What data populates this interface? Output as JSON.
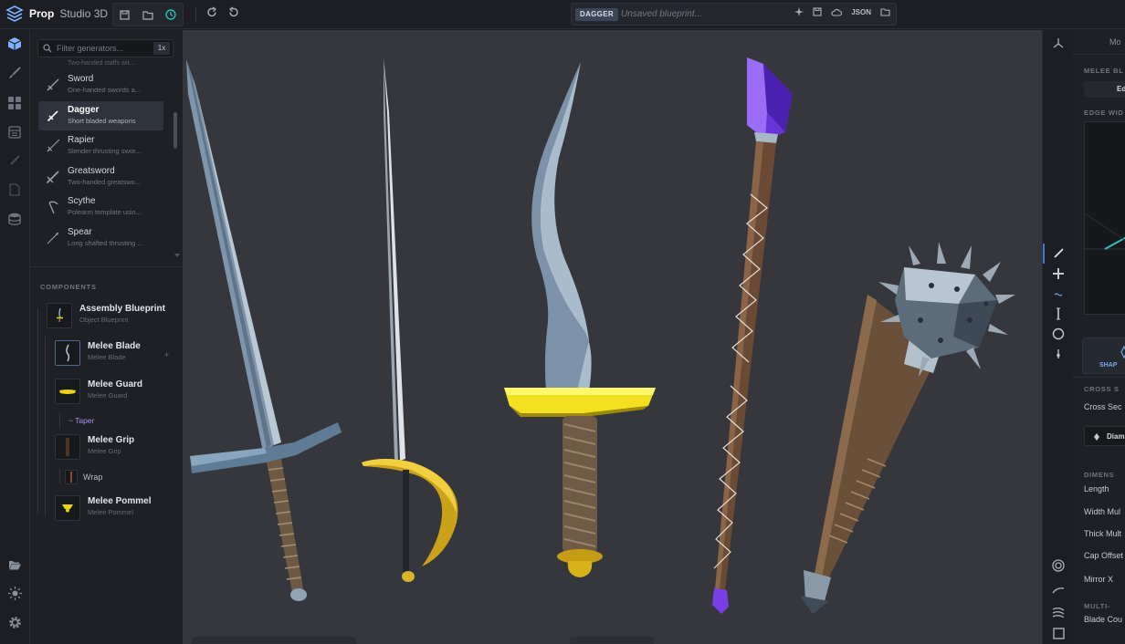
{
  "app": {
    "name_bold": "Prop",
    "name_rest": "Studio 3D"
  },
  "blueprint": {
    "badge": "DAGGER",
    "status": "Unsaved blueprint...",
    "json_label": "JSON"
  },
  "filter": {
    "placeholder": "Filter generators...",
    "zoom": "1x"
  },
  "generators": {
    "top_cut_text": "Two-handed staffs wit...",
    "items": [
      {
        "title": "Sword",
        "subtitle": "One-handed swords a..."
      },
      {
        "title": "Dagger",
        "subtitle": "Short bladed weapons",
        "selected": true
      },
      {
        "title": "Rapier",
        "subtitle": "Slender thrusting swor..."
      },
      {
        "title": "Greatsword",
        "subtitle": "Two-handed greatswo..."
      },
      {
        "title": "Scythe",
        "subtitle": "Polearm template usin..."
      },
      {
        "title": "Spear",
        "subtitle": "Long shafted thrusting ..."
      }
    ]
  },
  "components": {
    "header": "COMPONENTS",
    "items": [
      {
        "title": "Assembly Blueprint",
        "subtitle": "Object Blueprint"
      },
      {
        "title": "Melee Blade",
        "subtitle": "Melee Blade",
        "selected": true
      },
      {
        "title": "Melee Guard",
        "subtitle": "Melee Guard"
      },
      {
        "title": "Melee Grip",
        "subtitle": "Melee Grip"
      },
      {
        "title": "Melee Pommel",
        "subtitle": "Melee Pommel"
      }
    ],
    "taper": "~ Taper",
    "wrap": "Wrap",
    "plus": "+"
  },
  "right_panel": {
    "tab": "Mo",
    "section1": "MELEE BL",
    "edge_btn": "Ed",
    "edge_width": "EDGE WID",
    "shape_label": "SHAP",
    "cross": "CROSS S",
    "cross_section": "Cross Sec",
    "diamond": "Diam",
    "dimens": "DIMENS",
    "length": "Length",
    "width_mul": "Width Mul",
    "thick_mul": "Thick Mult",
    "cap_offset": "Cap Offset",
    "mirror": "Mirror X",
    "multi": "MULTI-",
    "blade_count": "Blade Cou"
  },
  "colors": {
    "accent_blue": "#3e7bd6",
    "teal": "#2bc1b6",
    "purple": "#a98cf2",
    "gold": "#e9d315",
    "viewport_bg": "#36373d"
  }
}
